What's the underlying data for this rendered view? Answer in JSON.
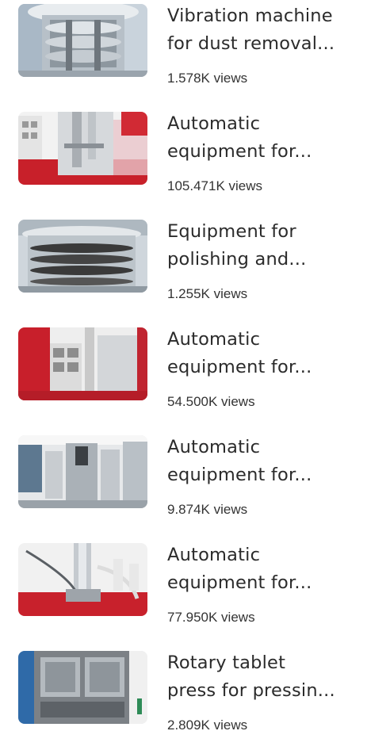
{
  "videos": [
    {
      "title_line1": "Vibration machine",
      "title_line2": "for dust removal...",
      "views": "1.578K views"
    },
    {
      "title_line1": "Automatic",
      "title_line2": "equipment for...",
      "views": "105.471K views"
    },
    {
      "title_line1": "Equipment for",
      "title_line2": "polishing and...",
      "views": "1.255K views"
    },
    {
      "title_line1": "Automatic",
      "title_line2": "equipment for...",
      "views": "54.500K views"
    },
    {
      "title_line1": "Automatic",
      "title_line2": "equipment for...",
      "views": "9.874K views"
    },
    {
      "title_line1": "Automatic",
      "title_line2": "equipment for...",
      "views": "77.950K views"
    },
    {
      "title_line1": "Rotary tablet",
      "title_line2": "press for pressin...",
      "views": "2.809K views"
    }
  ]
}
